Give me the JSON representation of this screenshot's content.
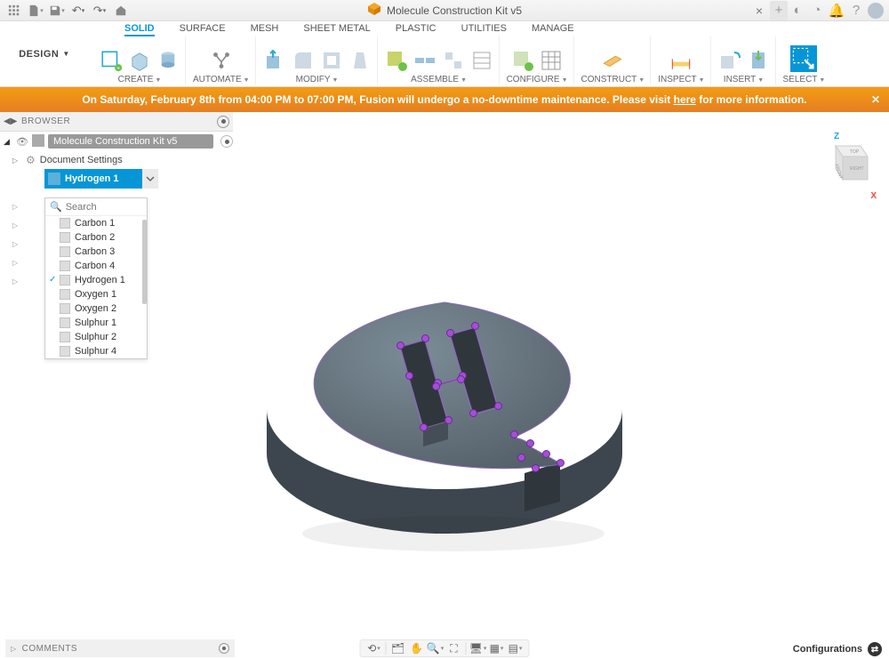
{
  "qat": {
    "title": "Molecule Construction Kit v5"
  },
  "design_button": "DESIGN",
  "ribbon": {
    "tabs": [
      "SOLID",
      "SURFACE",
      "MESH",
      "SHEET METAL",
      "PLASTIC",
      "UTILITIES",
      "MANAGE"
    ],
    "groups": {
      "create": "CREATE",
      "automate": "AUTOMATE",
      "modify": "MODIFY",
      "assemble": "ASSEMBLE",
      "configure": "CONFIGURE",
      "construct": "CONSTRUCT",
      "inspect": "INSPECT",
      "insert": "INSERT",
      "select": "SELECT"
    }
  },
  "banner": {
    "text_a": "On Saturday, February 8th from 04:00 PM to 07:00 PM, Fusion will undergo a no-downtime maintenance. Please visit ",
    "link": "here",
    "text_b": " for more information."
  },
  "browser": {
    "title": "BROWSER",
    "root": "Molecule Construction Kit v5",
    "docset": "Document Settings",
    "active_row": "Hydrogen 1",
    "dropdown": {
      "placeholder": "Search",
      "items": [
        "Carbon 1",
        "Carbon 2",
        "Carbon 3",
        "Carbon 4",
        "Hydrogen 1",
        "Oxygen 1",
        "Oxygen 2",
        "Sulphur 1",
        "Sulphur 2",
        "Sulphur 4"
      ],
      "selected_index": 4
    }
  },
  "viewcube": {
    "z": "Z",
    "x": "X",
    "top": "TOP",
    "front": "FRONT",
    "right": "RIGHT"
  },
  "comments": "COMMENTS",
  "configurations": "Configurations"
}
